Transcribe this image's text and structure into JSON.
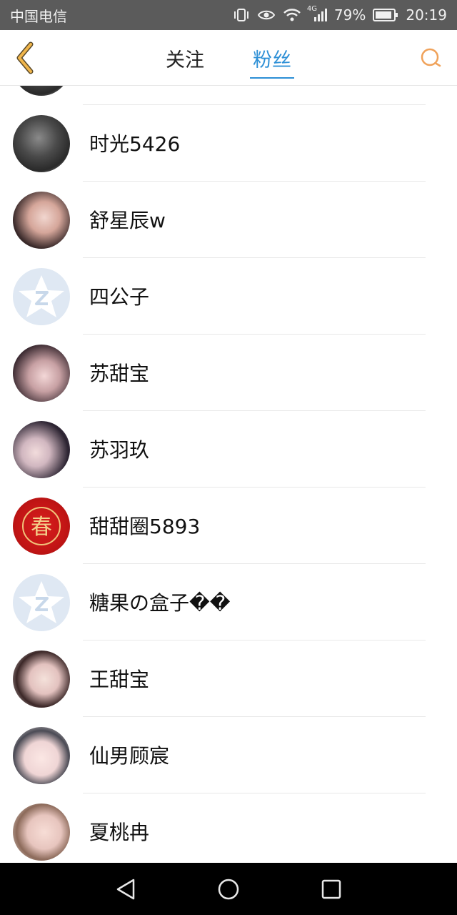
{
  "status_bar": {
    "carrier": "中国电信",
    "battery": "79%",
    "time": "20:19",
    "network": "4G",
    "icons": [
      "vibrate-icon",
      "eye-icon",
      "wifi-icon",
      "signal-icon",
      "battery-icon"
    ]
  },
  "header": {
    "tabs": [
      {
        "label": "关注",
        "active": false
      },
      {
        "label": "粉丝",
        "active": true
      }
    ],
    "accent_color": "#2c8fd6",
    "back_icon_color": "#f0b54a",
    "search_icon_color": "#f0a25a"
  },
  "fans": [
    {
      "name": "时光5426",
      "avatar": "photo"
    },
    {
      "name": "舒星辰w",
      "avatar": "photo"
    },
    {
      "name": "四公子",
      "avatar": "default-q-icon"
    },
    {
      "name": "苏甜宝",
      "avatar": "photo"
    },
    {
      "name": "苏羽玖",
      "avatar": "photo"
    },
    {
      "name": "甜甜圈5893",
      "avatar": "chun-character-image"
    },
    {
      "name": "糖果の盒子��",
      "avatar": "default-q-icon"
    },
    {
      "name": "王甜宝",
      "avatar": "photo"
    },
    {
      "name": "仙男顾宸",
      "avatar": "photo"
    },
    {
      "name": "夏桃冉",
      "avatar": "photo"
    }
  ],
  "avatar_glyph": "春"
}
